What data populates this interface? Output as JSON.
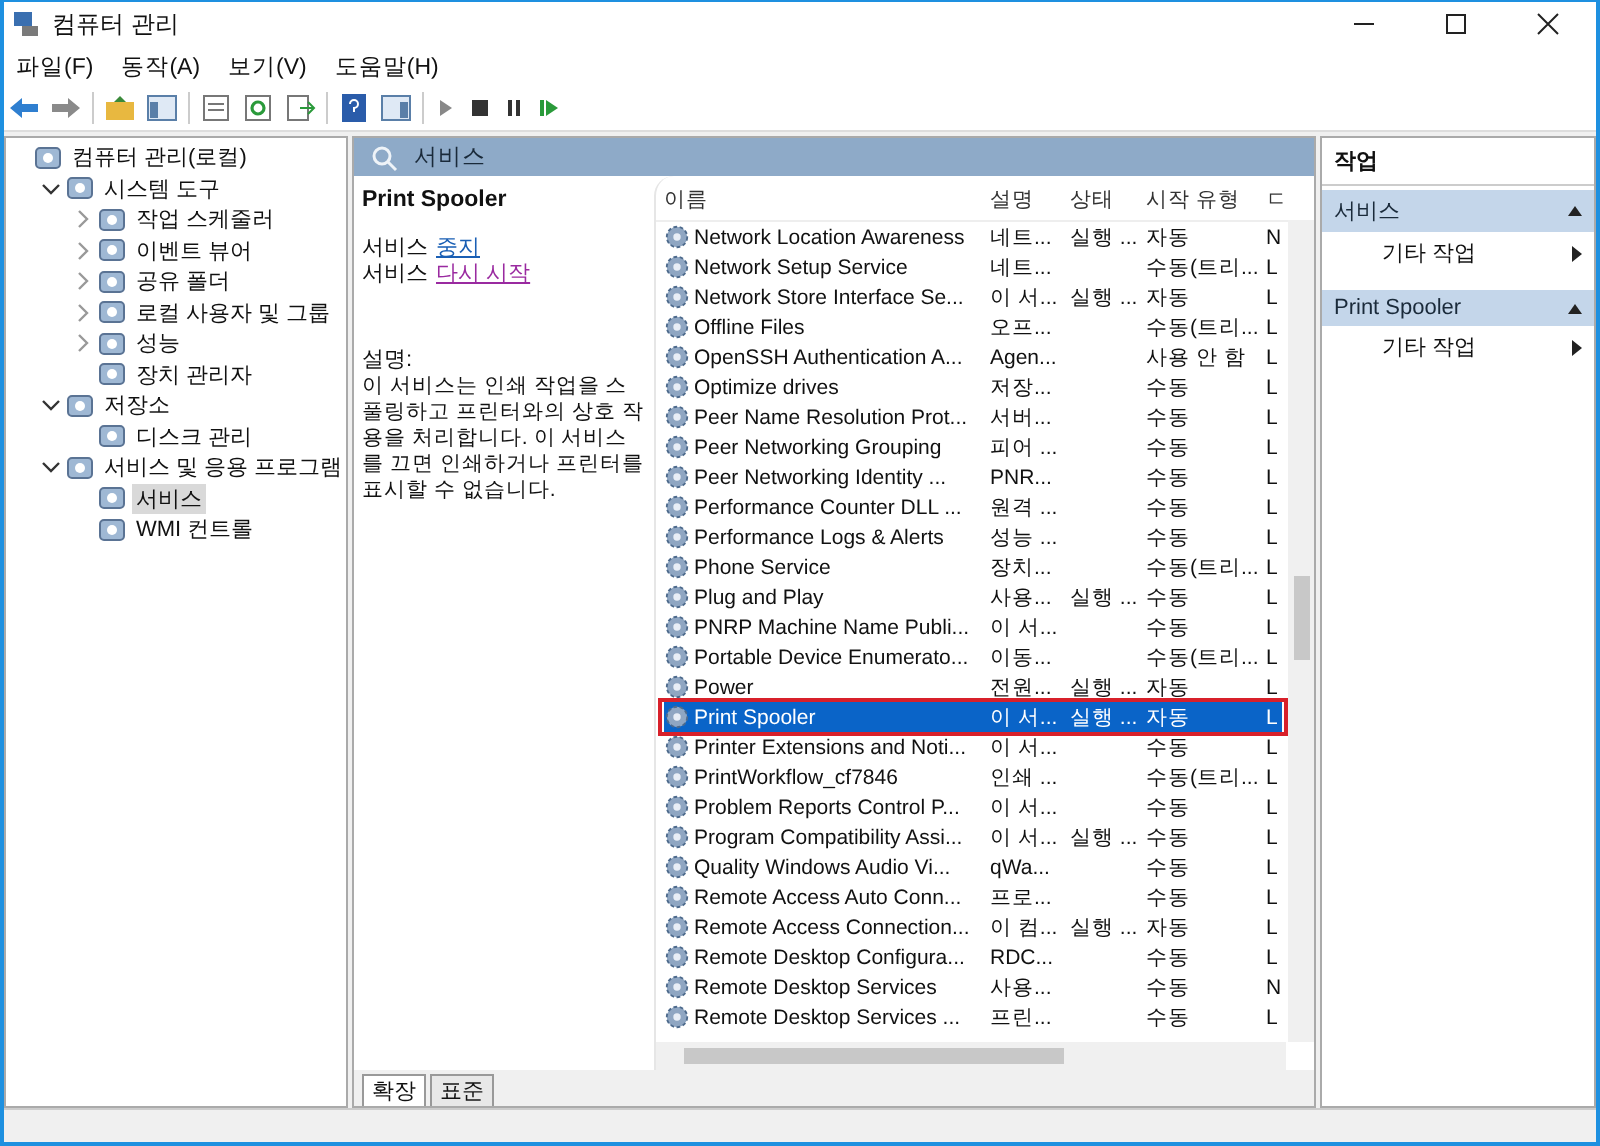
{
  "window": {
    "title": "컴퓨터 관리"
  },
  "menu": [
    "파일(F)",
    "동작(A)",
    "보기(V)",
    "도움말(H)"
  ],
  "tree": [
    {
      "label": "컴퓨터 관리(로컬)",
      "selected": false,
      "children": [
        {
          "label": "시스템 도구",
          "expanded": true,
          "selected": false,
          "children": [
            {
              "label": "작업 스케줄러",
              "expanded": false,
              "selected": false
            },
            {
              "label": "이벤트 뷰어",
              "expanded": false,
              "selected": false
            },
            {
              "label": "공유 폴더",
              "expanded": false,
              "selected": false
            },
            {
              "label": "로컬 사용자 및 그룹",
              "expanded": false,
              "selected": false
            },
            {
              "label": "성능",
              "expanded": false,
              "selected": false
            },
            {
              "label": "장치 관리자",
              "selected": false
            }
          ]
        },
        {
          "label": "저장소",
          "expanded": true,
          "selected": false,
          "children": [
            {
              "label": "디스크 관리",
              "selected": false
            }
          ]
        },
        {
          "label": "서비스 및 응용 프로그램",
          "expanded": true,
          "selected": false,
          "children": [
            {
              "label": "서비스",
              "selected": true
            },
            {
              "label": "WMI 컨트롤",
              "selected": false
            }
          ]
        }
      ]
    }
  ],
  "services_panel": {
    "title": "서비스",
    "detail": {
      "name": "Print Spooler",
      "actions": [
        {
          "prefix": "서비스",
          "link": "중지",
          "visited": false
        },
        {
          "prefix": "서비스",
          "link": "다시 시작",
          "visited": true
        }
      ],
      "description_label": "설명:",
      "description": "이 서비스는 인쇄 작업을 스풀링하고 프린터와의 상호 작용을 처리합니다. 이 서비스를 끄면 인쇄하거나 프린터를 표시할 수 없습니다."
    },
    "columns": [
      "이름",
      "설명",
      "상태",
      "시작 유형",
      "ㄷ"
    ],
    "rows": [
      {
        "name": "Network Location Awareness",
        "desc": "네트...",
        "status": "실행 ...",
        "startup": "자동",
        "column_5": "N",
        "selected": false,
        "highlighted": false
      },
      {
        "name": "Network Setup Service",
        "desc": "네트...",
        "status": "",
        "startup": "수동(트리...",
        "column_5": "L",
        "selected": false,
        "highlighted": false
      },
      {
        "name": "Network Store Interface Se...",
        "desc": "이 서...",
        "status": "실행 ...",
        "startup": "자동",
        "column_5": "L",
        "selected": false,
        "highlighted": false
      },
      {
        "name": "Offline Files",
        "desc": "오프...",
        "status": "",
        "startup": "수동(트리...",
        "column_5": "L",
        "selected": false,
        "highlighted": false
      },
      {
        "name": "OpenSSH Authentication A...",
        "desc": "Agen...",
        "status": "",
        "startup": "사용 안 함",
        "column_5": "L",
        "selected": false,
        "highlighted": false
      },
      {
        "name": "Optimize drives",
        "desc": "저장...",
        "status": "",
        "startup": "수동",
        "column_5": "L",
        "selected": false,
        "highlighted": false
      },
      {
        "name": "Peer Name Resolution Prot...",
        "desc": "서버...",
        "status": "",
        "startup": "수동",
        "column_5": "L",
        "selected": false,
        "highlighted": false
      },
      {
        "name": "Peer Networking Grouping",
        "desc": "피어 ...",
        "status": "",
        "startup": "수동",
        "column_5": "L",
        "selected": false,
        "highlighted": false
      },
      {
        "name": "Peer Networking Identity ...",
        "desc": "PNR...",
        "status": "",
        "startup": "수동",
        "column_5": "L",
        "selected": false,
        "highlighted": false
      },
      {
        "name": "Performance Counter DLL ...",
        "desc": "원격 ...",
        "status": "",
        "startup": "수동",
        "column_5": "L",
        "selected": false,
        "highlighted": false
      },
      {
        "name": "Performance Logs & Alerts",
        "desc": "성능 ...",
        "status": "",
        "startup": "수동",
        "column_5": "L",
        "selected": false,
        "highlighted": false
      },
      {
        "name": "Phone Service",
        "desc": "장치...",
        "status": "",
        "startup": "수동(트리...",
        "column_5": "L",
        "selected": false,
        "highlighted": false
      },
      {
        "name": "Plug and Play",
        "desc": "사용...",
        "status": "실행 ...",
        "startup": "수동",
        "column_5": "L",
        "selected": false,
        "highlighted": false
      },
      {
        "name": "PNRP Machine Name Publi...",
        "desc": "이 서...",
        "status": "",
        "startup": "수동",
        "column_5": "L",
        "selected": false,
        "highlighted": false
      },
      {
        "name": "Portable Device Enumerato...",
        "desc": "이동...",
        "status": "",
        "startup": "수동(트리...",
        "column_5": "L",
        "selected": false,
        "highlighted": false
      },
      {
        "name": "Power",
        "desc": "전원...",
        "status": "실행 ...",
        "startup": "자동",
        "column_5": "L",
        "selected": false,
        "highlighted": false
      },
      {
        "name": "Print Spooler",
        "desc": "이 서...",
        "status": "실행 ...",
        "startup": "자동",
        "column_5": "L",
        "selected": true,
        "highlighted": true
      },
      {
        "name": "Printer Extensions and Noti...",
        "desc": "이 서...",
        "status": "",
        "startup": "수동",
        "column_5": "L",
        "selected": false,
        "highlighted": false
      },
      {
        "name": "PrintWorkflow_cf7846",
        "desc": "인쇄 ...",
        "status": "",
        "startup": "수동(트리...",
        "column_5": "L",
        "selected": false,
        "highlighted": false
      },
      {
        "name": "Problem Reports Control P...",
        "desc": "이 서...",
        "status": "",
        "startup": "수동",
        "column_5": "L",
        "selected": false,
        "highlighted": false
      },
      {
        "name": "Program Compatibility Assi...",
        "desc": "이 서...",
        "status": "실행 ...",
        "startup": "수동",
        "column_5": "L",
        "selected": false,
        "highlighted": false
      },
      {
        "name": "Quality Windows Audio Vi...",
        "desc": "qWa...",
        "status": "",
        "startup": "수동",
        "column_5": "L",
        "selected": false,
        "highlighted": false
      },
      {
        "name": "Remote Access Auto Conn...",
        "desc": "프로...",
        "status": "",
        "startup": "수동",
        "column_5": "L",
        "selected": false,
        "highlighted": false
      },
      {
        "name": "Remote Access Connection...",
        "desc": "이 컴...",
        "status": "실행 ...",
        "startup": "자동",
        "column_5": "L",
        "selected": false,
        "highlighted": false
      },
      {
        "name": "Remote Desktop Configura...",
        "desc": "RDC...",
        "status": "",
        "startup": "수동",
        "column_5": "L",
        "selected": false,
        "highlighted": false
      },
      {
        "name": "Remote Desktop Services",
        "desc": "사용...",
        "status": "",
        "startup": "수동",
        "column_5": "N",
        "selected": false,
        "highlighted": false
      },
      {
        "name": "Remote Desktop Services ...",
        "desc": "프린...",
        "status": "",
        "startup": "수동",
        "column_5": "L",
        "selected": false,
        "highlighted": false
      }
    ],
    "tabs": [
      {
        "label": "확장",
        "selected": true
      },
      {
        "label": "표준",
        "selected": false
      }
    ]
  },
  "actions_pane": {
    "title": "작업",
    "sections": [
      {
        "title": "서비스",
        "items": [
          "기타 작업"
        ]
      },
      {
        "title": "Print Spooler",
        "items": [
          "기타 작업"
        ]
      }
    ]
  }
}
